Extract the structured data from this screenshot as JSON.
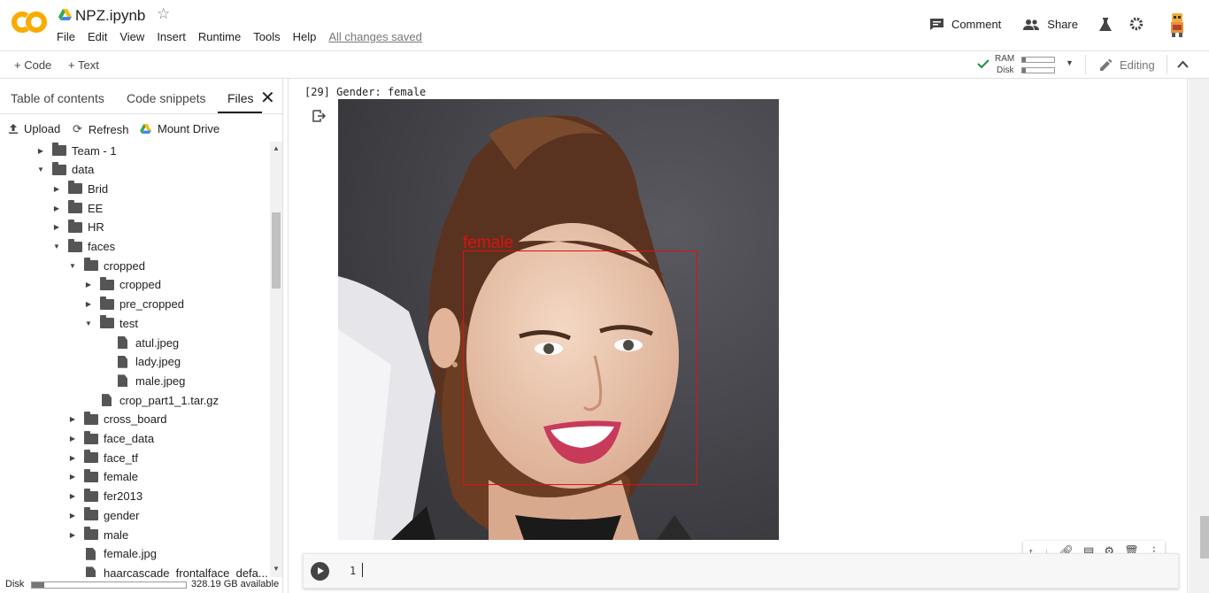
{
  "header": {
    "logo_text": "CO",
    "notebook_title": "NPZ.ipynb",
    "menu": [
      "File",
      "Edit",
      "View",
      "Insert",
      "Runtime",
      "Tools",
      "Help"
    ],
    "save_status": "All changes saved",
    "comment_label": "Comment",
    "share_label": "Share"
  },
  "toolbar": {
    "add_code_label": "+ Code",
    "add_text_label": "+ Text",
    "ram_label": "RAM",
    "disk_label": "Disk",
    "ram_usage_fraction": 0.12,
    "disk_usage_fraction": 0.1,
    "editing_label": "Editing"
  },
  "sidebar": {
    "tabs": [
      "Table of contents",
      "Code snippets",
      "Files"
    ],
    "active_tab": "Files",
    "actions": [
      "Upload",
      "Refresh",
      "Mount Drive"
    ],
    "tree": [
      {
        "name": "Team - 1",
        "type": "folder",
        "depth": 0,
        "expanded": false
      },
      {
        "name": "data",
        "type": "folder",
        "depth": 0,
        "expanded": true
      },
      {
        "name": "Brid",
        "type": "folder",
        "depth": 1,
        "expanded": false
      },
      {
        "name": "EE",
        "type": "folder",
        "depth": 1,
        "expanded": false
      },
      {
        "name": "HR",
        "type": "folder",
        "depth": 1,
        "expanded": false
      },
      {
        "name": "faces",
        "type": "folder",
        "depth": 1,
        "expanded": true
      },
      {
        "name": "cropped",
        "type": "folder",
        "depth": 2,
        "expanded": true
      },
      {
        "name": "cropped",
        "type": "folder",
        "depth": 3,
        "expanded": false
      },
      {
        "name": "pre_cropped",
        "type": "folder",
        "depth": 3,
        "expanded": false
      },
      {
        "name": "test",
        "type": "folder",
        "depth": 3,
        "expanded": true
      },
      {
        "name": "atul.jpeg",
        "type": "file",
        "depth": 4
      },
      {
        "name": "lady.jpeg",
        "type": "file",
        "depth": 4
      },
      {
        "name": "male.jpeg",
        "type": "file",
        "depth": 4
      },
      {
        "name": "crop_part1_1.tar.gz",
        "type": "file",
        "depth": 3
      },
      {
        "name": "cross_board",
        "type": "folder",
        "depth": 2,
        "expanded": false
      },
      {
        "name": "face_data",
        "type": "folder",
        "depth": 2,
        "expanded": false
      },
      {
        "name": "face_tf",
        "type": "folder",
        "depth": 2,
        "expanded": false
      },
      {
        "name": "female",
        "type": "folder",
        "depth": 2,
        "expanded": false
      },
      {
        "name": "fer2013",
        "type": "folder",
        "depth": 2,
        "expanded": false
      },
      {
        "name": "gender",
        "type": "folder",
        "depth": 2,
        "expanded": false
      },
      {
        "name": "male",
        "type": "folder",
        "depth": 2,
        "expanded": false
      },
      {
        "name": "female.jpg",
        "type": "file",
        "depth": 2
      },
      {
        "name": "haarcascade_frontalface_defa...",
        "type": "file",
        "depth": 2
      }
    ],
    "disk_label": "Disk",
    "disk_available": "328.19 GB available",
    "disk_usage_fraction": 0.08
  },
  "output": {
    "execution_count": "[29]",
    "text": "Gender: female",
    "detection_label": "female"
  },
  "code_cell": {
    "line_number": "1"
  },
  "colors": {
    "logo_orange": "#f9ab00",
    "box_red": "#dd1111",
    "check_green": "#1e8e3e"
  }
}
